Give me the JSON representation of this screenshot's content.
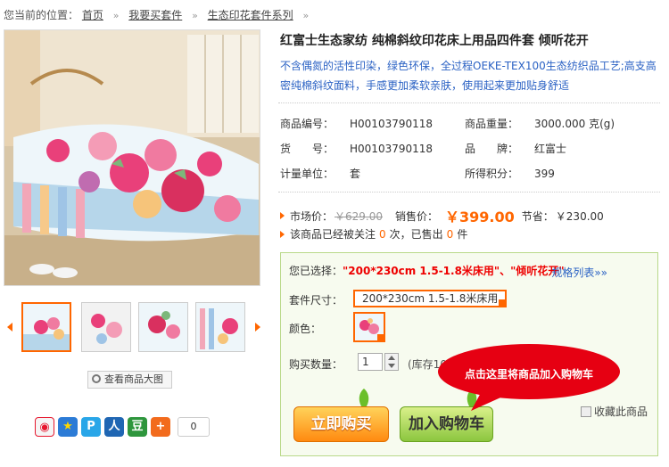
{
  "breadcrumb": {
    "prefix": "您当前的位置：",
    "items": [
      "首页",
      "我要买套件",
      "生态印花套件系列"
    ],
    "sep": "»"
  },
  "gallery": {
    "view_big_label": "查看商品大图"
  },
  "share": {
    "count": "0",
    "icons": [
      "weibo-icon",
      "qzone-icon",
      "pengyou-icon",
      "renren-icon",
      "douban-icon",
      "more-icon"
    ]
  },
  "product": {
    "title": "红富士生态家纺 纯棉斜纹印花床上用品四件套 倾听花开",
    "description": "不含偶氮的活性印染，绿色环保，全过程OEKE-TEX100生态纺织品工艺;高支高密纯棉斜纹面料，手感更加柔软亲肤，使用起来更加贴身舒适",
    "attrs": {
      "sku_label": "商品编号：",
      "sku": "H00103790118",
      "weight_label": "商品重量：",
      "weight": "3000.000  克(g)",
      "item_no_label": "货　　号：",
      "item_no": "H00103790118",
      "brand_label": "品　　牌：",
      "brand": "红富士",
      "unit_label": "计量单位：",
      "unit": "套",
      "points_label": "所得积分：",
      "points": "399"
    },
    "price": {
      "market_label": "市场价：",
      "market": "￥629.00",
      "sale_label": "销售价：",
      "sale": "￥399.00",
      "save_label": "节省：",
      "save": "￥230.00"
    },
    "stats": {
      "pre": "该商品已经被关注",
      "views": "0",
      "mid": "次，已售出",
      "sold": "0",
      "post": "件"
    }
  },
  "selection": {
    "chosen_label": "您已选择：",
    "chosen_value": "\"200*230cm 1.5-1.8米床用\"、\"倾听花开\"",
    "spec_link": "规格列表»»",
    "size_label": "套件尺寸：",
    "size_value": "200*230cm 1.5-1.8米床用",
    "color_label": "颜色：",
    "qty_label": "购买数量：",
    "qty_value": "1",
    "stock": "(库存100",
    "buy_now": "立即购买",
    "add_cart": "加入购物车",
    "favorite": "收藏此商品"
  },
  "tooltip": {
    "text": "点击这里将商品加入购物车",
    "color": "#e60012"
  },
  "colors": {
    "accent": "#ff6600",
    "link": "#2b62c4",
    "price": "#ff6600"
  }
}
